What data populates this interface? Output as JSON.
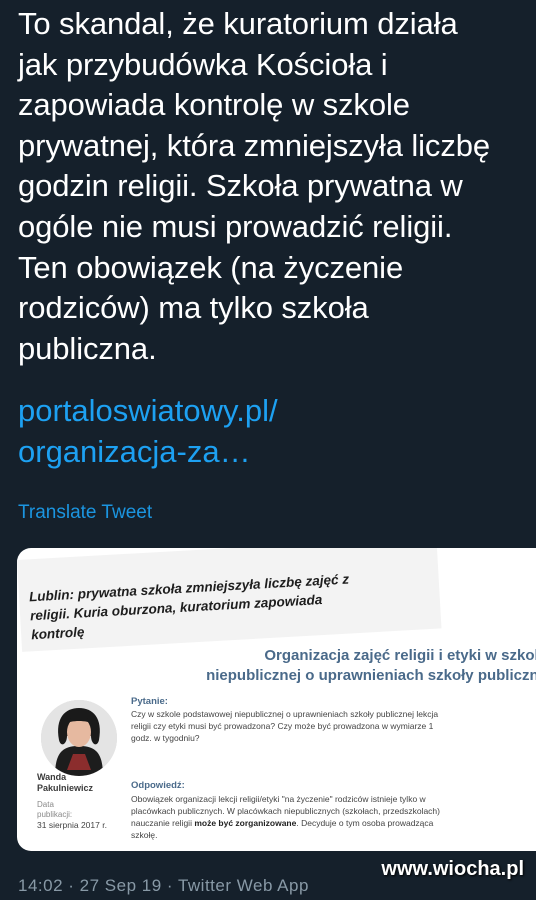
{
  "tweet": {
    "text": "To skandal, że kuratorium działa\njak przybudówka Kościoła i\nzapowiada kontrolę w szkole\nprywatnej, która zmniejszyła liczbę\ngodzin religii. Szkoła prywatna w\nogóle nie musi prowadzić religii.\nTen obowiązek (na życzenie\nrodziców) ma tylko szkoła\npubliczna.",
    "link": "portaloswiatowy.pl/\norganizacja-za…",
    "translate_label": "Translate Tweet"
  },
  "card": {
    "headline": "Lublin: prywatna szkoła zmniejszyła liczbę zajęć z\nreligii. Kuria oburzona, kuratorium zapowiada\nkontrolę",
    "article_title": "Organizacja zajęć religii i etyki w szkole\nniepublicznej o uprawnieniach szkoły publiczne",
    "author_name": "Wanda\nPakulniewicz",
    "date_label": "Data\npublikacji:",
    "date_value": "31 sierpnia 2017 r.",
    "question_label": "Pytanie:",
    "question_text": "Czy w szkole podstawowej niepublicznej o uprawnieniach szkoły publicznej lekcja religii czy etyki musi być prowadzona? Czy może być prowadzona w wymiarze 1 godz. w tygodniu?",
    "answer_label": "Odpowiedź:",
    "answer_text_1": "Obowiązek organizacji lekcji religii/etyki \"na życzenie\" rodziców istnieje tylko w placówkach publicznych. W placówkach niepublicznych (szkołach, przedszkolach) nauczanie religii ",
    "answer_text_bold": "może być zorganizowane",
    "answer_text_2": ". Decyduje o tym osoba prowadząca szkołę."
  },
  "status_bar": "14:02 · 27 Sep 19 · Twitter Web App",
  "watermark": "www.wiocha.pl"
}
